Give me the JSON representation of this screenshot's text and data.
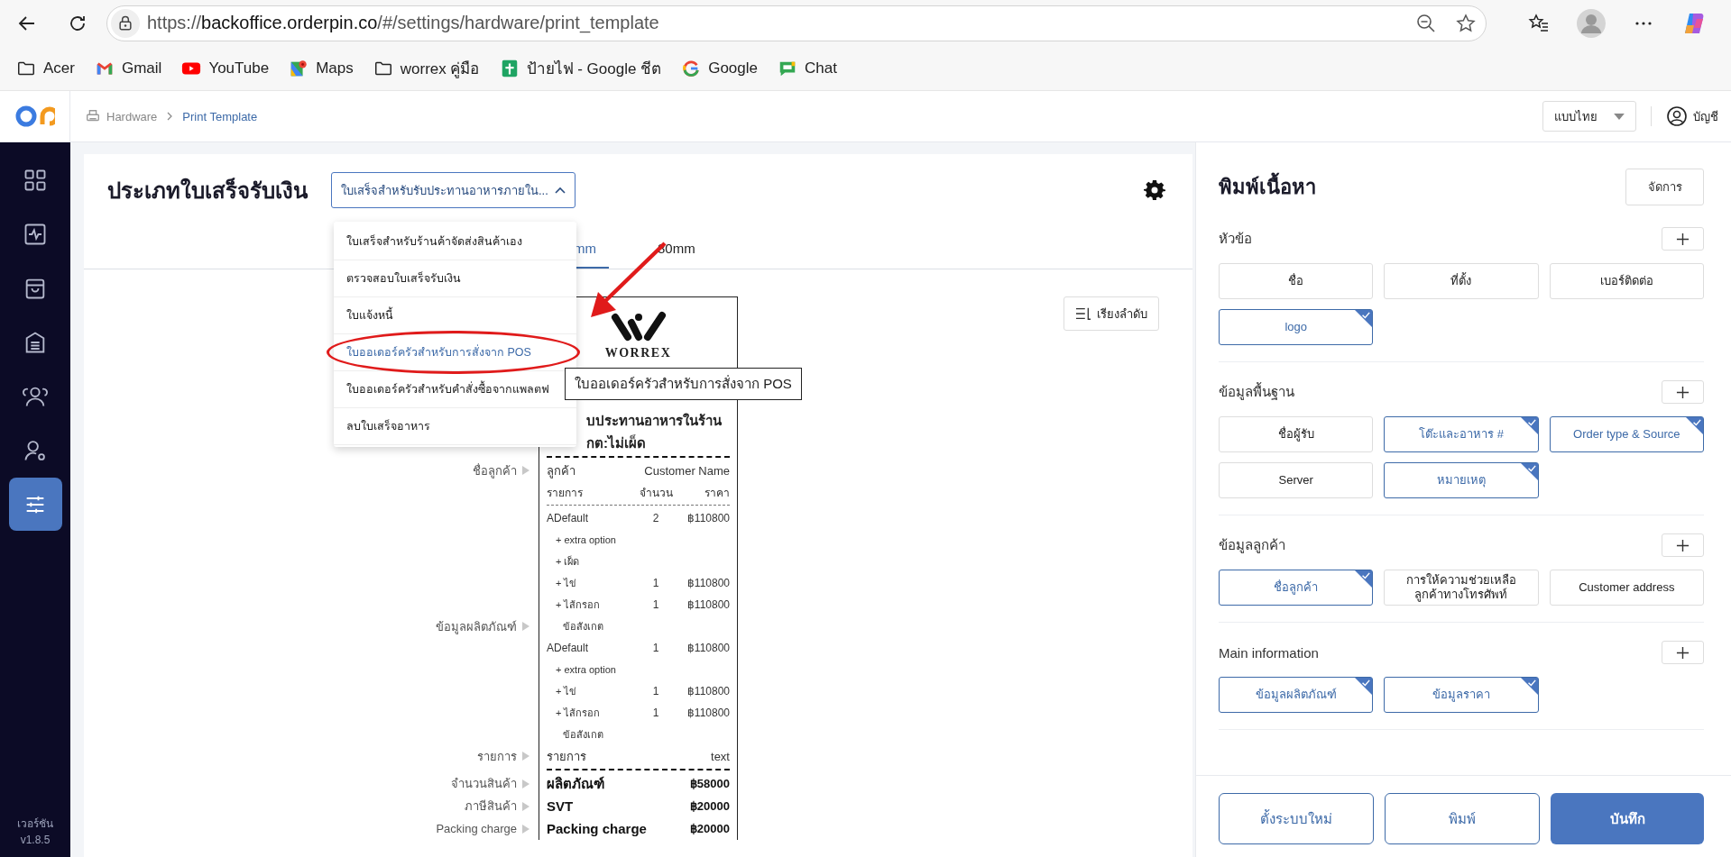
{
  "browser": {
    "url": {
      "scheme": "https://",
      "host": "backoffice.orderpin.co",
      "path": "/#/settings/hardware/print_template"
    }
  },
  "bookmarks": [
    {
      "kind": "folder",
      "label": "Acer"
    },
    {
      "kind": "gmail",
      "label": "Gmail"
    },
    {
      "kind": "youtube",
      "label": "YouTube"
    },
    {
      "kind": "maps",
      "label": "Maps"
    },
    {
      "kind": "folder",
      "label": "worrex คู่มือ"
    },
    {
      "kind": "sheets",
      "label": "ป้ายไฟ - Google ชีต"
    },
    {
      "kind": "google",
      "label": "Google"
    },
    {
      "kind": "chat",
      "label": "Chat"
    }
  ],
  "header": {
    "breadcrumb": [
      {
        "label": "Hardware",
        "current": false
      },
      {
        "label": "Print Template",
        "current": true
      }
    ],
    "language": "แบบไทย",
    "account": "บัญชี"
  },
  "sidebar": {
    "items": [
      {
        "kind": "grid",
        "selected": false
      },
      {
        "kind": "activity",
        "selected": false
      },
      {
        "kind": "bag",
        "selected": false
      },
      {
        "kind": "register",
        "selected": false
      },
      {
        "kind": "people",
        "selected": false
      },
      {
        "kind": "user-settings",
        "selected": false
      },
      {
        "kind": "sliders",
        "selected": true
      }
    ],
    "version_label": "เวอร์ชัน",
    "version": "v1.8.5"
  },
  "template": {
    "title": "ประเภทใบเสร็จรับเงิน",
    "select_value": "ใบเสร็จสำหรับรับประทานอาหารภายใน...",
    "expanded": true,
    "options": [
      {
        "label": "ใบเสร็จสำหรับร้านค้าจัดส่งสินค้าเอง",
        "selected": false,
        "circled": false
      },
      {
        "label": "ตรวจสอบใบเสร็จรับเงิน",
        "selected": false,
        "circled": false
      },
      {
        "label": "ใบแจ้งหนี้",
        "selected": false,
        "circled": false
      },
      {
        "label": "ใบออเดอร์ครัวสำหรับการสั่งจาก POS",
        "selected": true,
        "circled": true
      },
      {
        "label": "ใบออเดอร์ครัวสำหรับคำสั่งซื้อจากแพลตฟ",
        "selected": false,
        "circled": false
      },
      {
        "label": "ลบใบเสร็จอาหาร",
        "selected": false,
        "circled": false
      }
    ],
    "tabs": [
      {
        "label": "mm",
        "selected": true
      },
      {
        "label": "80mm",
        "selected": false
      }
    ],
    "sort_button": "เรียงลำดับ",
    "tooltip": "ใบออเดอร์ครัวสำหรับการสั่งจาก POS",
    "receipt": {
      "brand": "WORREX",
      "title_lines": [
        "บประทานอาหารในร้าน",
        "กต:ไม่เผ็ด"
      ],
      "sections": [
        {
          "rows": [
            {
              "kind": "rule"
            }
          ]
        },
        {
          "label": "ชื่อลูกค้า",
          "rows": [
            {
              "kind": "pair",
              "cells": [
                "ลูกค้า",
                "Customer Name"
              ]
            }
          ]
        },
        {
          "rows": [
            {
              "kind": "header",
              "cells": [
                "รายการ",
                "จำนวน",
                "ราคา"
              ]
            },
            {
              "kind": "dash"
            }
          ]
        },
        {
          "label": "ข้อมูลผลิตภัณฑ์",
          "rows": [
            {
              "kind": "item",
              "cells": [
                "ADefault",
                "2",
                "฿110800"
              ]
            },
            {
              "kind": "option",
              "cells": [
                "+ extra option"
              ]
            },
            {
              "kind": "option",
              "cells": [
                "+ เผ็ด"
              ]
            },
            {
              "kind": "option",
              "cells": [
                "+ ไข่",
                "1",
                "฿110800"
              ]
            },
            {
              "kind": "option",
              "cells": [
                "+ ไส้กรอก",
                "1",
                "฿110800"
              ]
            },
            {
              "kind": "note",
              "cells": [
                "ข้อสังเกต"
              ]
            },
            {
              "kind": "item",
              "cells": [
                "ADefault",
                "1",
                "฿110800"
              ]
            },
            {
              "kind": "option",
              "cells": [
                "+ extra option"
              ]
            },
            {
              "kind": "option",
              "cells": [
                "+ ไข่",
                "1",
                "฿110800"
              ]
            },
            {
              "kind": "option",
              "cells": [
                "+ ไส้กรอก",
                "1",
                "฿110800"
              ]
            },
            {
              "kind": "note",
              "cells": [
                "ข้อสังเกต"
              ]
            }
          ]
        },
        {
          "label": "รายการ",
          "rows": [
            {
              "kind": "pair",
              "cells": [
                "รายการ",
                "text"
              ]
            }
          ]
        },
        {
          "rows": [
            {
              "kind": "rule"
            }
          ]
        },
        {
          "label": "จำนวนสินค้า",
          "rows": [
            {
              "kind": "total",
              "cells": [
                "ผลิตภัณฑ์",
                "฿58000"
              ]
            }
          ]
        },
        {
          "label": "ภาษีสินค้า",
          "rows": [
            {
              "kind": "total",
              "cells": [
                "SVT",
                "฿20000"
              ]
            }
          ]
        },
        {
          "label": "Packing charge",
          "rows": [
            {
              "kind": "total",
              "cells": [
                "Packing charge",
                "฿20000"
              ]
            }
          ]
        }
      ]
    }
  },
  "content_panel": {
    "title": "พิมพ์เนื้อหา",
    "manage_button": "จัดการ",
    "sections": [
      {
        "title": "หัวข้อ",
        "chips": [
          {
            "label": "ชื่อ",
            "selected": false
          },
          {
            "label": "ที่ตั้ง",
            "selected": false
          },
          {
            "label": "เบอร์ติดต่อ",
            "selected": false
          },
          {
            "label": "logo",
            "selected": true
          }
        ]
      },
      {
        "title": "ข้อมูลพื้นฐาน",
        "chips": [
          {
            "label": "ชื่อผู้รับ",
            "selected": false
          },
          {
            "label": "โต๊ะและอาหาร #",
            "selected": true
          },
          {
            "label": "Order type & Source",
            "selected": true
          },
          {
            "label": "Server",
            "selected": false
          },
          {
            "label": "หมายเหตุ",
            "selected": true
          }
        ]
      },
      {
        "title": "ข้อมูลลูกค้า",
        "chips": [
          {
            "label": "ชื่อลูกค้า",
            "selected": true
          },
          {
            "label": "การให้ความช่วยเหลือลูกค้าทางโทรศัพท์",
            "selected": false
          },
          {
            "label": "Customer address",
            "selected": false
          }
        ]
      },
      {
        "title": "Main information",
        "chips": [
          {
            "label": "ข้อมูลผลิตภัณฑ์",
            "selected": true
          },
          {
            "label": "ข้อมูลราคา",
            "selected": true
          }
        ]
      }
    ],
    "footer_buttons": [
      {
        "label": "ตั้งระบบใหม่",
        "kind": "outline"
      },
      {
        "label": "พิมพ์",
        "kind": "outline"
      },
      {
        "label": "บันทึก",
        "kind": "primary"
      }
    ]
  }
}
